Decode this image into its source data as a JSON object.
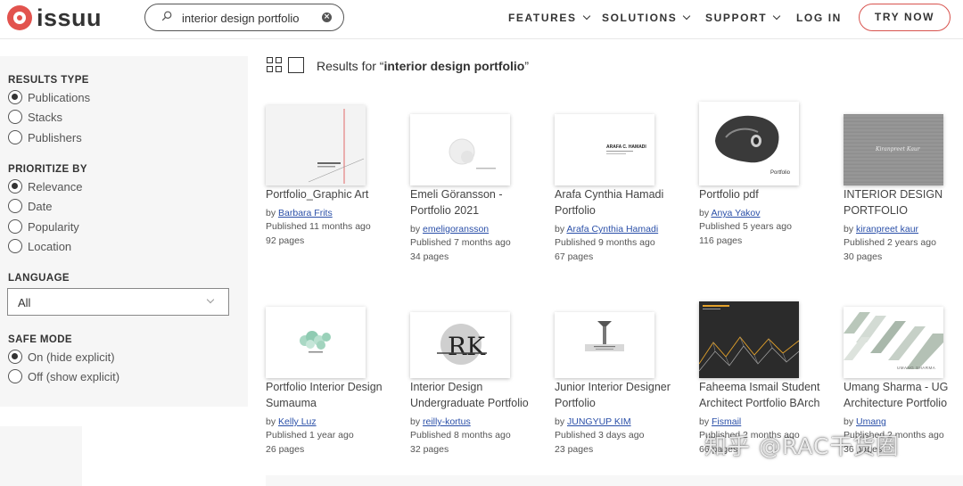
{
  "header": {
    "logo_text": "issuu",
    "search": {
      "value": "interior design portfolio"
    },
    "nav": [
      {
        "label": "FEATURES"
      },
      {
        "label": "SOLUTIONS"
      },
      {
        "label": "SUPPORT"
      },
      {
        "label": "LOG IN"
      }
    ],
    "try_now": "TRY NOW",
    "accent_color": "#e2534e"
  },
  "sidebar": {
    "results_type": {
      "title": "RESULTS TYPE",
      "options": [
        {
          "label": "Publications",
          "selected": true
        },
        {
          "label": "Stacks",
          "selected": false
        },
        {
          "label": "Publishers",
          "selected": false
        }
      ]
    },
    "prioritize_by": {
      "title": "PRIORITIZE BY",
      "options": [
        {
          "label": "Relevance",
          "selected": true
        },
        {
          "label": "Date",
          "selected": false
        },
        {
          "label": "Popularity",
          "selected": false
        },
        {
          "label": "Location",
          "selected": false
        }
      ]
    },
    "language": {
      "title": "LANGUAGE",
      "selected": "All"
    },
    "safe_mode": {
      "title": "SAFE MODE",
      "options": [
        {
          "label": "On (hide explicit)",
          "selected": true
        },
        {
          "label": "Off (show explicit)",
          "selected": false
        }
      ]
    }
  },
  "results": {
    "prefix": "Results for “",
    "query": "interior design portfolio",
    "suffix": "”",
    "items": [
      {
        "title": "Portfolio_Graphic Art",
        "by": "by ",
        "author": "Barbara Frits",
        "published": "Published 11 months ago",
        "pages": "92 pages"
      },
      {
        "title": "Emeli Göransson - Portfolio 2021",
        "by": "by ",
        "author": "emeligoransson",
        "published": "Published 7 months ago",
        "pages": "34 pages"
      },
      {
        "title": "Arafa Cynthia Hamadi Portfolio",
        "by": "by ",
        "author": "Arafa Cynthia Hamadi",
        "published": "Published 9 months ago",
        "pages": "67 pages",
        "cover_text": "ARAFA C. HAMADI"
      },
      {
        "title": "Portfolio pdf",
        "by": "by ",
        "author": "Anya Yakov",
        "published": "Published 5 years ago",
        "pages": "116 pages",
        "cover_text": "Portfolio"
      },
      {
        "title": "INTERIOR DESIGN PORTFOLIO",
        "by": "by ",
        "author": "kiranpreet kaur",
        "published": "Published 2 years ago",
        "pages": "30 pages",
        "cover_text": "Kiranpreet Kaur"
      },
      {
        "title": "Portfolio Interior Design Sumauma",
        "by": "by ",
        "author": "Kelly Luz",
        "published": "Published 1 year ago",
        "pages": "26 pages"
      },
      {
        "title": "Interior Design Undergraduate Portfolio",
        "by": "by ",
        "author": "reilly-kortus",
        "published": "Published 8 months ago",
        "pages": "32 pages"
      },
      {
        "title": "Junior Interior Designer Portfolio",
        "by": "by ",
        "author": "JUNGYUP KIM",
        "published": "Published 3 days ago",
        "pages": "23 pages"
      },
      {
        "title": "Faheema Ismail Student Architect Portfolio BArch",
        "by": "by ",
        "author": "Fismail",
        "published": "Published 2 months ago",
        "pages": "66 pages"
      },
      {
        "title": "Umang Sharma - UG Architecture Portfolio",
        "by": "by ",
        "author": "Umang",
        "published": "Published 2 months ago",
        "pages": "36 pages",
        "cover_text": "UMANG SHARMA"
      }
    ]
  },
  "watermark": "知乎 @RAC干货圈"
}
